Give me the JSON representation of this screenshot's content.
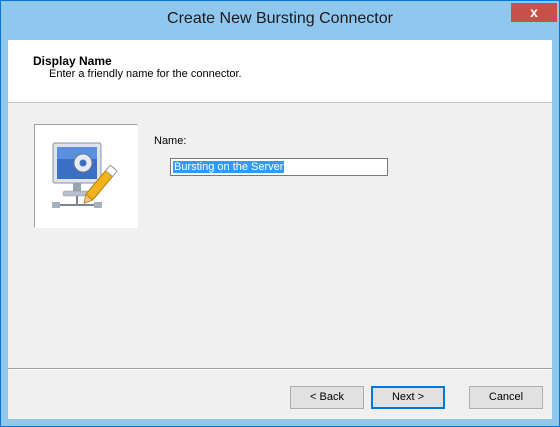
{
  "window": {
    "title": "Create New Bursting Connector",
    "close_label": "x"
  },
  "header": {
    "title": "Display Name",
    "subtitle": "Enter a friendly name for the connector."
  },
  "icon": {
    "name": "connector-wizard-icon"
  },
  "form": {
    "name_label": "Name:",
    "name_value": "Bursting on the Server"
  },
  "buttons": {
    "back": "< Back",
    "next": "Next >",
    "cancel": "Cancel"
  },
  "colors": {
    "titlebar": "#8fc7ef",
    "close": "#c7504b",
    "selection": "#3399ff",
    "dialog_bg": "#f0f0f0"
  }
}
